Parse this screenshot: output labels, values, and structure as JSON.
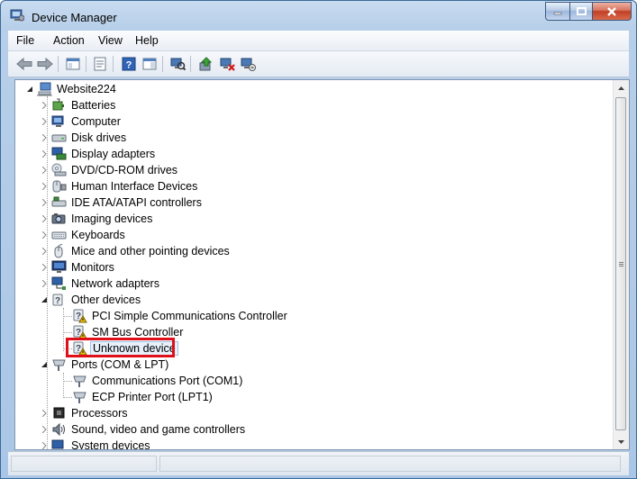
{
  "window": {
    "title": "Device Manager"
  },
  "menu": [
    "File",
    "Action",
    "View",
    "Help"
  ],
  "tree": {
    "root": "Website224",
    "categories": [
      "Batteries",
      "Computer",
      "Disk drives",
      "Display adapters",
      "DVD/CD-ROM drives",
      "Human Interface Devices",
      "IDE ATA/ATAPI controllers",
      "Imaging devices",
      "Keyboards",
      "Mice and other pointing devices",
      "Monitors",
      "Network adapters",
      "Other devices"
    ],
    "other_devices": [
      "PCI Simple Communications Controller",
      "SM Bus Controller",
      "Unknown device"
    ],
    "ports": "Ports (COM & LPT)",
    "ports_children": [
      "Communications Port (COM1)",
      "ECP Printer Port (LPT1)"
    ],
    "after_ports": [
      "Processors",
      "Sound, video and game controllers",
      "System devices"
    ]
  },
  "colors": {
    "highlight_box": "#e0101a",
    "warning": "#f2c511"
  }
}
